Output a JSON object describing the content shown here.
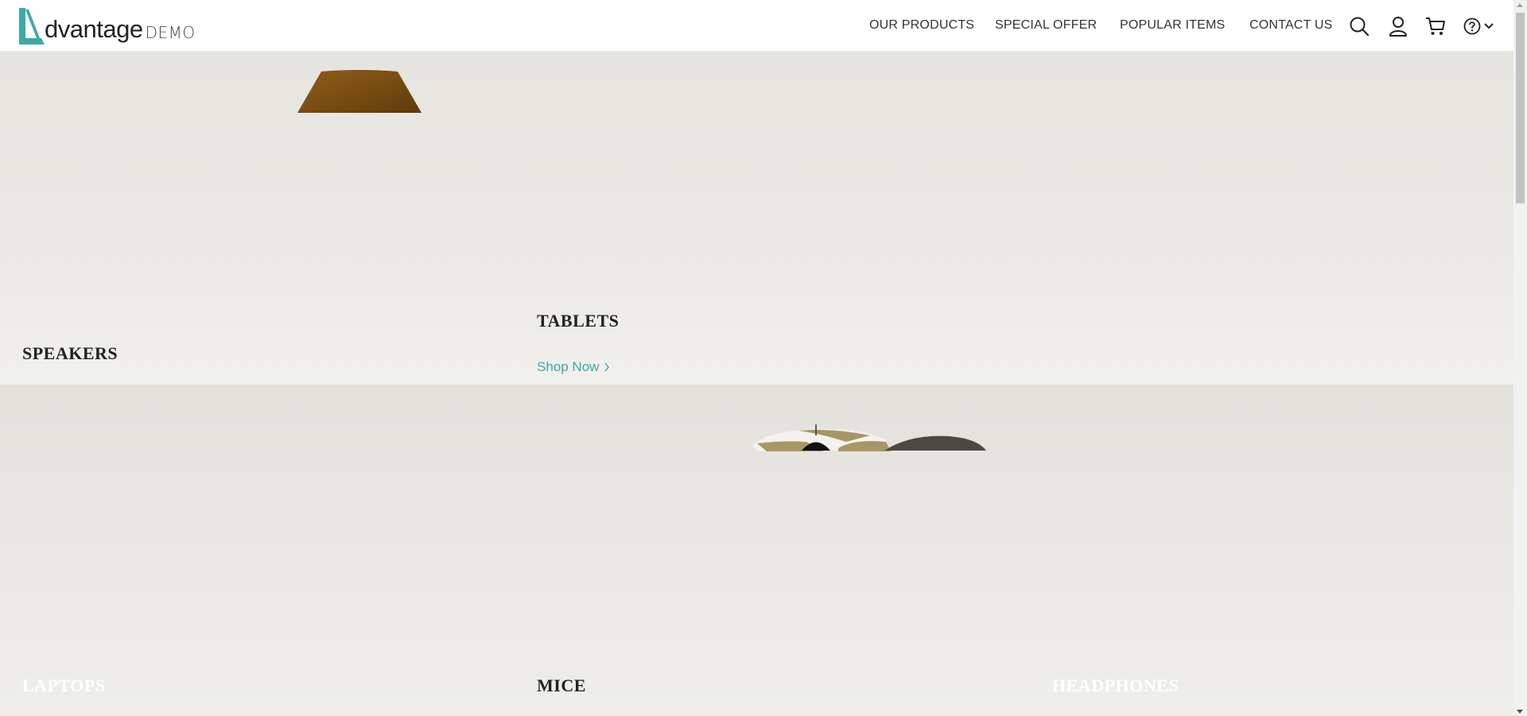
{
  "brand": {
    "logo_letter": "A",
    "name": "dvantage",
    "suffix": "DEMO",
    "accent_color": "#3fa9a4"
  },
  "nav": {
    "links": [
      "OUR PRODUCTS",
      "SPECIAL OFFER",
      "POPULAR ITEMS",
      "CONTACT US"
    ],
    "icons": [
      "search-icon",
      "user-icon",
      "cart-icon",
      "help-icon",
      "chevron-down-icon"
    ]
  },
  "categories": {
    "speakers": {
      "title": "SPEAKERS"
    },
    "tablets": {
      "title": "TABLETS",
      "cta": "Shop Now"
    },
    "laptops": {
      "title": "LAPTOPS"
    },
    "mice": {
      "title": "MICE"
    },
    "headphones": {
      "title": "HEADPHONES"
    }
  }
}
